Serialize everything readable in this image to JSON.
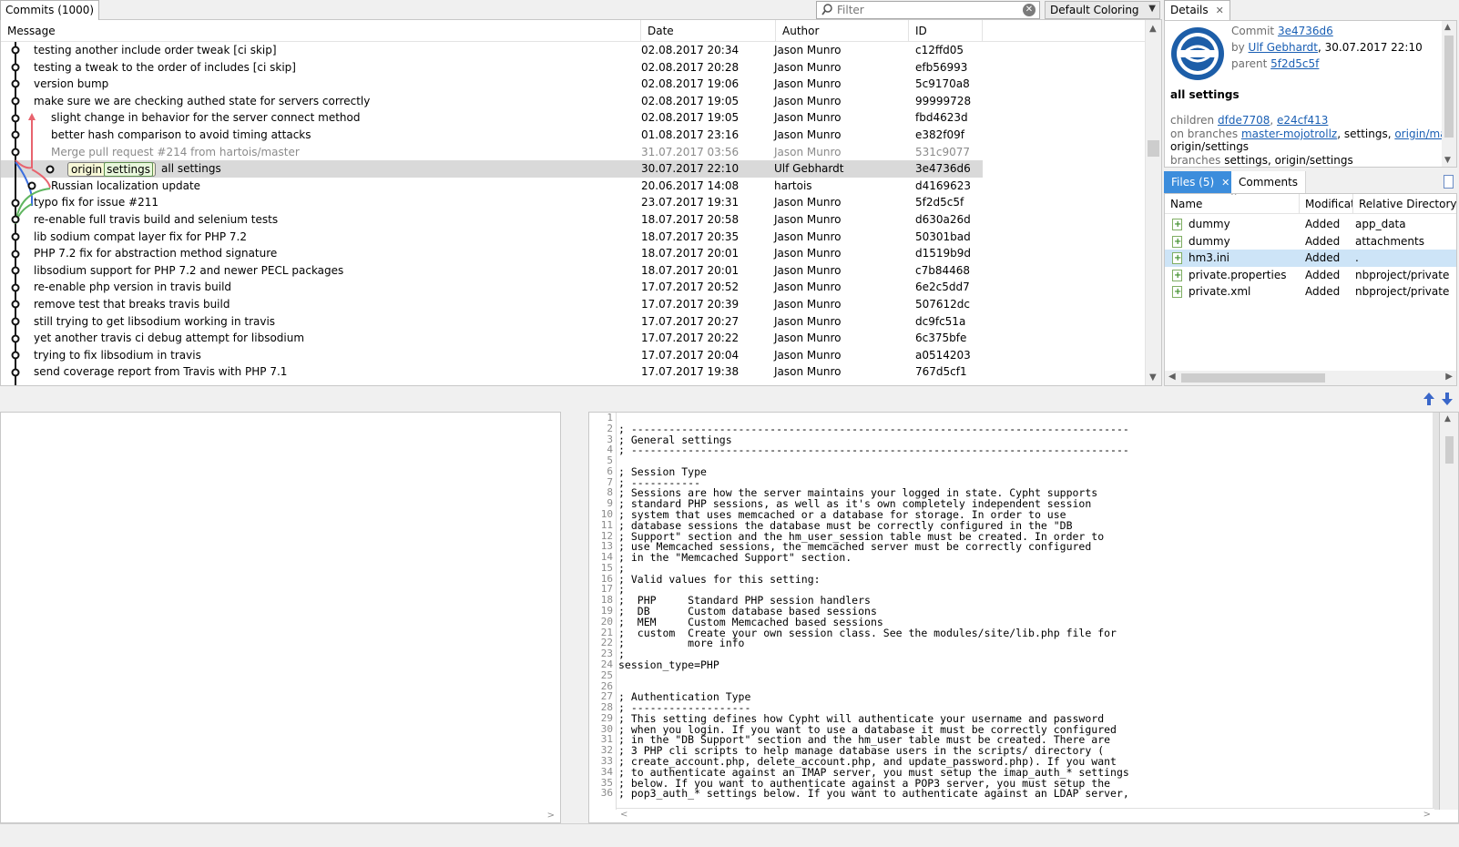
{
  "top": {
    "commits_tab": "Commits (1000)",
    "filter_placeholder": "Filter",
    "coloring": "Default Coloring"
  },
  "table": {
    "headers": [
      "Message",
      "Date",
      "Author",
      "ID"
    ],
    "rows": [
      {
        "msg": "testing another include order tweak [ci skip]",
        "date": "02.08.2017 20:34",
        "author": "Jason Munro",
        "id": "c12ffd05"
      },
      {
        "msg": "testing a tweak to the order of includes [ci skip]",
        "date": "02.08.2017 20:28",
        "author": "Jason Munro",
        "id": "efb56993"
      },
      {
        "msg": "version bump",
        "date": "02.08.2017 19:06",
        "author": "Jason Munro",
        "id": "5c9170a8"
      },
      {
        "msg": "make sure we are checking authed state for servers correctly",
        "date": "02.08.2017 19:05",
        "author": "Jason Munro",
        "id": "99999728"
      },
      {
        "msg": "slight change in behavior for the server connect method",
        "date": "02.08.2017 19:05",
        "author": "Jason Munro",
        "id": "fbd4623d"
      },
      {
        "msg": "better hash comparison to avoid timing attacks",
        "date": "01.08.2017 23:16",
        "author": "Jason Munro",
        "id": "e382f09f"
      },
      {
        "msg": "Merge pull request #214 from hartois/master",
        "date": "31.07.2017 03:56",
        "author": "Jason Munro",
        "id": "531c9077"
      },
      {
        "msg": "all settings",
        "date": "30.07.2017 22:10",
        "author": "Ulf Gebhardt",
        "id": "3e4736d6",
        "ref1": "origin",
        "ref2": "settings"
      },
      {
        "msg": "Russian localization update",
        "date": "20.06.2017 14:08",
        "author": "hartois",
        "id": "d4169623"
      },
      {
        "msg": "typo fix for issue #211",
        "date": "23.07.2017 19:31",
        "author": "Jason Munro",
        "id": "5f2d5c5f"
      },
      {
        "msg": "re-enable full travis build and selenium tests",
        "date": "18.07.2017 20:58",
        "author": "Jason Munro",
        "id": "d630a26d"
      },
      {
        "msg": "lib sodium compat layer fix for PHP 7.2",
        "date": "18.07.2017 20:35",
        "author": "Jason Munro",
        "id": "50301bad"
      },
      {
        "msg": "PHP 7.2 fix for abstraction method signature",
        "date": "18.07.2017 20:01",
        "author": "Jason Munro",
        "id": "d1519b9d"
      },
      {
        "msg": "libsodium support for PHP 7.2 and newer PECL packages",
        "date": "18.07.2017 20:01",
        "author": "Jason Munro",
        "id": "c7b84468"
      },
      {
        "msg": "re-enable php version in travis build",
        "date": "17.07.2017 20:52",
        "author": "Jason Munro",
        "id": "6e2c5dd7"
      },
      {
        "msg": "remove test that breaks travis build",
        "date": "17.07.2017 20:39",
        "author": "Jason Munro",
        "id": "507612dc"
      },
      {
        "msg": "still trying to get libsodium working in travis",
        "date": "17.07.2017 20:27",
        "author": "Jason Munro",
        "id": "dc9fc51a"
      },
      {
        "msg": "yet another travis ci debug attempt for libsodium",
        "date": "17.07.2017 20:22",
        "author": "Jason Munro",
        "id": "6c375bfe"
      },
      {
        "msg": "trying to fix libsodium in travis",
        "date": "17.07.2017 20:04",
        "author": "Jason Munro",
        "id": "a0514203"
      },
      {
        "msg": "send coverage report from Travis with PHP 7.1",
        "date": "17.07.2017 19:38",
        "author": "Jason Munro",
        "id": "767d5cf1"
      }
    ]
  },
  "details": {
    "tab": "Details",
    "commit_label": "Commit",
    "commit_hash": "3e4736d6",
    "by_label": "by",
    "author": "Ulf Gebhardt",
    "date": ", 30.07.2017 22:10",
    "parent_label": "parent",
    "parent_hash": "5f2d5c5f",
    "title": "all settings",
    "children_label": "children",
    "child1": "dfde7708",
    "child2": "e24cf413",
    "on_branches_label": "on branches",
    "branch1": "master-mojotrollz",
    "branch_sep1": ", settings, ",
    "branch2": "origin/master",
    "branch_sep2": ",",
    "branch3": "origin/settings",
    "branches_label": "branches",
    "branches_value": "settings, origin/settings"
  },
  "files": {
    "tab": "Files (5)",
    "comments_tab": "Comments",
    "headers": [
      "Name",
      "Modificati",
      "Relative Directory"
    ],
    "rows": [
      {
        "name": "dummy",
        "mod": "Added",
        "dir": "app_data"
      },
      {
        "name": "dummy",
        "mod": "Added",
        "dir": "attachments"
      },
      {
        "name": "hm3.ini",
        "mod": "Added",
        "dir": "."
      },
      {
        "name": "private.properties",
        "mod": "Added",
        "dir": "nbproject/private"
      },
      {
        "name": "private.xml",
        "mod": "Added",
        "dir": "nbproject/private"
      }
    ]
  },
  "code": {
    "lines": [
      "",
      "; -------------------------------------------------------------------------------",
      "; General settings",
      "; -------------------------------------------------------------------------------",
      "",
      "; Session Type",
      "; -----------",
      "; Sessions are how the server maintains your logged in state. Cypht supports",
      "; standard PHP sessions, as well as it's own completely independent session",
      "; system that uses memcached or a database for storage. In order to use",
      "; database sessions the database must be correctly configured in the \"DB",
      "; Support\" section and the hm_user_session table must be created. In order to",
      "; use Memcached sessions, the memcached server must be correctly configured",
      "; in the \"Memcached Support\" section.",
      ";",
      "; Valid values for this setting:",
      ";",
      ";  PHP     Standard PHP session handlers",
      ";  DB      Custom database based sessions",
      ";  MEM     Custom Memcached based sessions",
      ";  custom  Create your own session class. See the modules/site/lib.php file for",
      ";          more info",
      ";",
      "session_type=PHP",
      "",
      "",
      "; Authentication Type",
      "; -------------------",
      "; This setting defines how Cypht will authenticate your username and password",
      "; when you login. If you want to use a database it must be correctly configured",
      "; in the \"DB Support\" section and the hm_user table must be created. There are",
      "; 3 PHP cli scripts to help manage database users in the scripts/ directory (",
      "; create_account.php, delete_account.php, and update_password.php). If you want",
      "; to authenticate against an IMAP server, you must setup the imap_auth_* settings",
      "; below. If you want to authenticate against a POP3 server, you must setup the",
      "; pop3_auth_* settings below. If you want to authenticate against an LDAP server,"
    ]
  }
}
